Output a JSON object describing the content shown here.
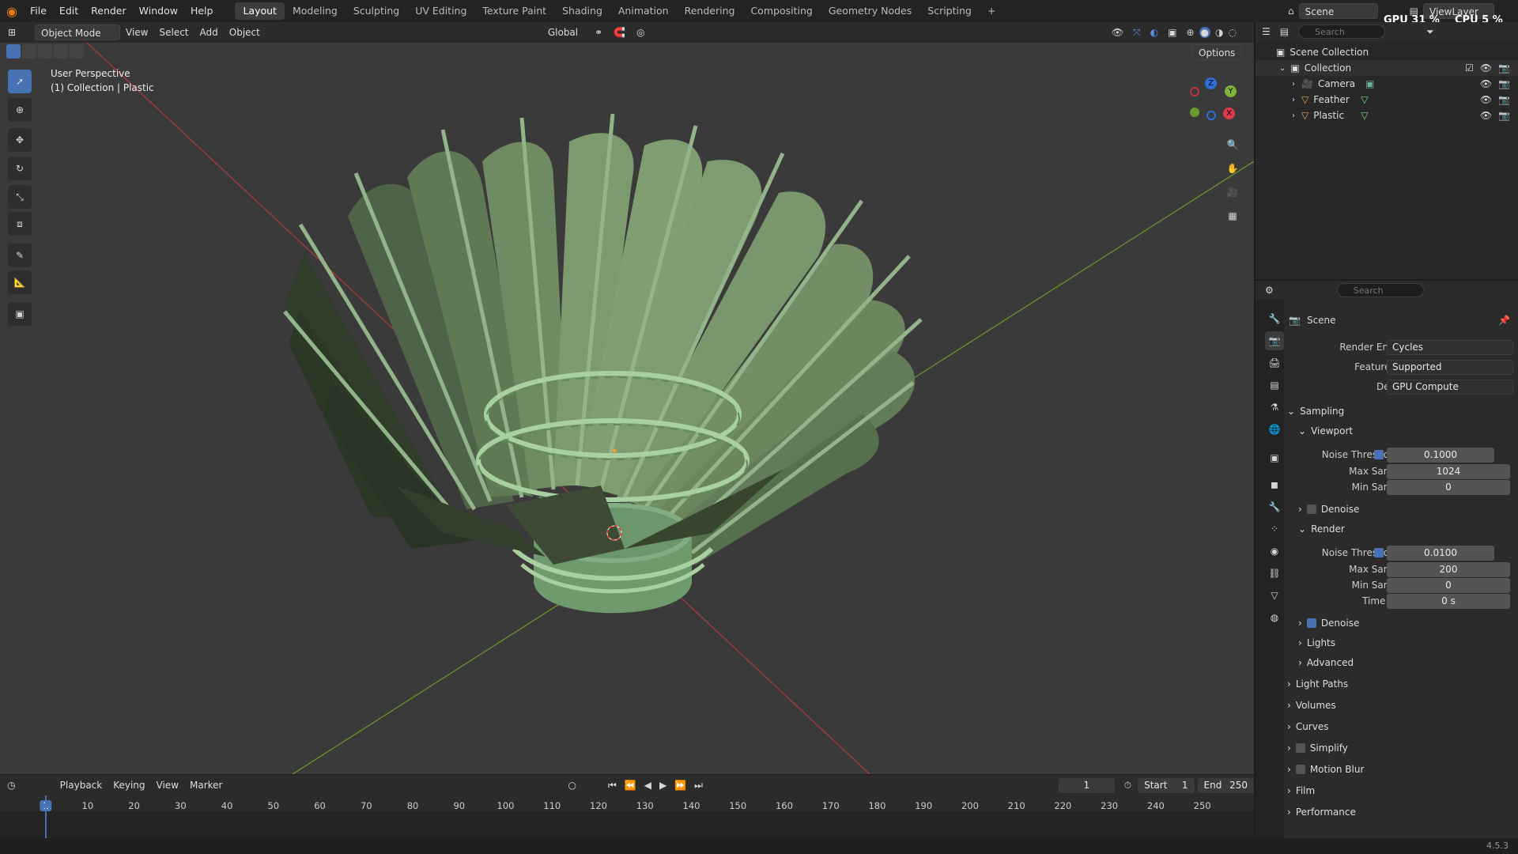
{
  "menus": [
    "File",
    "Edit",
    "Render",
    "Window",
    "Help"
  ],
  "workspaces": [
    "Layout",
    "Modeling",
    "Sculpting",
    "UV Editing",
    "Texture Paint",
    "Shading",
    "Animation",
    "Rendering",
    "Compositing",
    "Geometry Nodes",
    "Scripting",
    "+"
  ],
  "active_workspace": "Layout",
  "scene_selector": "Scene",
  "viewlayer_selector": "ViewLayer",
  "gpu_usage": "GPU 31 %",
  "cpu_usage": "CPU 5 %",
  "viewport_header": {
    "mode": "Object Mode",
    "view": "View",
    "select": "Select",
    "add": "Add",
    "object": "Object",
    "orientation": "Global",
    "options": "Options"
  },
  "viewport": {
    "perspective_label": "User Perspective",
    "collection_label": "(1) Collection | Plastic",
    "gizmo": {
      "x": "X",
      "y": "Y",
      "z": "Z"
    }
  },
  "outliner": {
    "search_placeholder": "Search",
    "root": "Scene Collection",
    "collection": "Collection",
    "items": [
      {
        "name": "Camera",
        "icon": "camera-icon"
      },
      {
        "name": "Feather",
        "icon": "mesh-icon"
      },
      {
        "name": "Plastic",
        "icon": "mesh-icon"
      }
    ]
  },
  "properties": {
    "search_placeholder": "Search",
    "title": "Scene",
    "render_engine_label": "Render Engine",
    "render_engine": "Cycles",
    "feature_set_label": "Feature Set",
    "feature_set": "Supported",
    "device_label": "Device",
    "device": "GPU Compute",
    "sampling": "Sampling",
    "viewport_sub": "Viewport",
    "render_sub": "Render",
    "noise_threshold_label": "Noise Threshold",
    "max_samples_label": "Max Samples",
    "min_samples_label": "Min Samples",
    "time_limit_label": "Time Limit",
    "vp_noise": "0.1000",
    "vp_max": "1024",
    "vp_min": "0",
    "r_noise": "0.0100",
    "r_max": "200",
    "r_min": "0",
    "r_time": "0 s",
    "denoise": "Denoise",
    "lights": "Lights",
    "advanced": "Advanced",
    "light_paths": "Light Paths",
    "volumes": "Volumes",
    "curves": "Curves",
    "simplify": "Simplify",
    "motion_blur": "Motion Blur",
    "film": "Film",
    "performance": "Performance"
  },
  "timeline": {
    "playback": "Playback",
    "keying": "Keying",
    "view": "View",
    "marker": "Marker",
    "current_frame": "1",
    "start_label": "Start",
    "start": "1",
    "end_label": "End",
    "end": "250",
    "ticks": [
      "1",
      "10",
      "20",
      "30",
      "40",
      "50",
      "60",
      "70",
      "80",
      "90",
      "100",
      "110",
      "120",
      "130",
      "140",
      "150",
      "160",
      "170",
      "180",
      "190",
      "200",
      "210",
      "220",
      "230",
      "240",
      "250"
    ]
  },
  "version": "4.5.3",
  "colors": {
    "accent": "#4772b3",
    "feather_light": "#8aa277",
    "feather_dark": "#3f5238",
    "cork": "#6e9a6e",
    "x_axis": "#b03a3a",
    "y_axis": "#6a9a2a"
  }
}
